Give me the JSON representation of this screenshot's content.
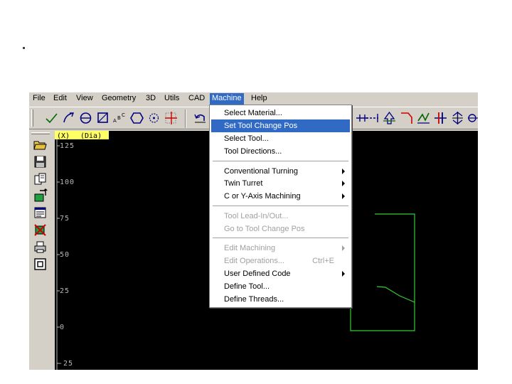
{
  "menubar": {
    "items": [
      "File",
      "Edit",
      "View",
      "Geometry",
      "3D",
      "Utils",
      "CAD",
      "Machine",
      "Help"
    ]
  },
  "toolbar": {
    "icons": [
      "line-tool-icon",
      "arc-tool-icon",
      "circle-tool-icon",
      "rectangle-tool-icon",
      "text-abc-icon",
      "hexagon-icon",
      "target-circle-icon",
      "point-grid-icon",
      "undo-icon",
      "dimension-icon",
      "chamfer-icon",
      "arrow-tool-icon",
      "angle-tool-icon",
      "chamfer-line-icon",
      "zigzag-tool-icon",
      "thread-tool-icon",
      "offset-tool-icon",
      "more-tool-icon"
    ]
  },
  "left_toolbar": {
    "icons": [
      "open-folder-icon",
      "save-disk-icon",
      "copy-files-icon",
      "load-tool-icon",
      "edit-form-icon",
      "delete-tool-icon",
      "print-icon",
      "frame-view-icon"
    ]
  },
  "canvas": {
    "header": {
      "x_label": "(X)",
      "dia_label": "(Dia)"
    },
    "ruler_labels": [
      "125",
      "100",
      "75",
      "50",
      "25",
      "0",
      "-25"
    ],
    "geometry_color": "#33cc33",
    "background_color": "#000000"
  },
  "dropdown": {
    "items": [
      {
        "label": "Select Material...",
        "state": "normal"
      },
      {
        "label": "Set Tool Change Pos",
        "state": "highlight"
      },
      {
        "label": "Select Tool...",
        "state": "normal"
      },
      {
        "label": "Tool Directions...",
        "state": "normal"
      },
      {
        "label": "Conventional Turning",
        "state": "normal",
        "submenu": true
      },
      {
        "label": "Twin Turret",
        "state": "normal",
        "submenu": true
      },
      {
        "label": "C or Y-Axis Machining",
        "state": "normal",
        "submenu": true
      },
      {
        "label": "Tool Lead-In/Out...",
        "state": "disabled"
      },
      {
        "label": "Go to Tool Change Pos",
        "state": "disabled"
      },
      {
        "label": "Edit Machining",
        "state": "disabled",
        "submenu": true
      },
      {
        "label": "Edit Operations...",
        "state": "disabled",
        "shortcut": "Ctrl+E"
      },
      {
        "label": "User Defined Code",
        "state": "normal",
        "submenu": true
      },
      {
        "label": "Define Tool...",
        "state": "normal"
      },
      {
        "label": "Define Threads...",
        "state": "normal"
      }
    ]
  },
  "colors": {
    "menu_highlight": "#316ac5",
    "window_face": "#d4d0c8",
    "disabled_text": "#a0a0a0"
  }
}
